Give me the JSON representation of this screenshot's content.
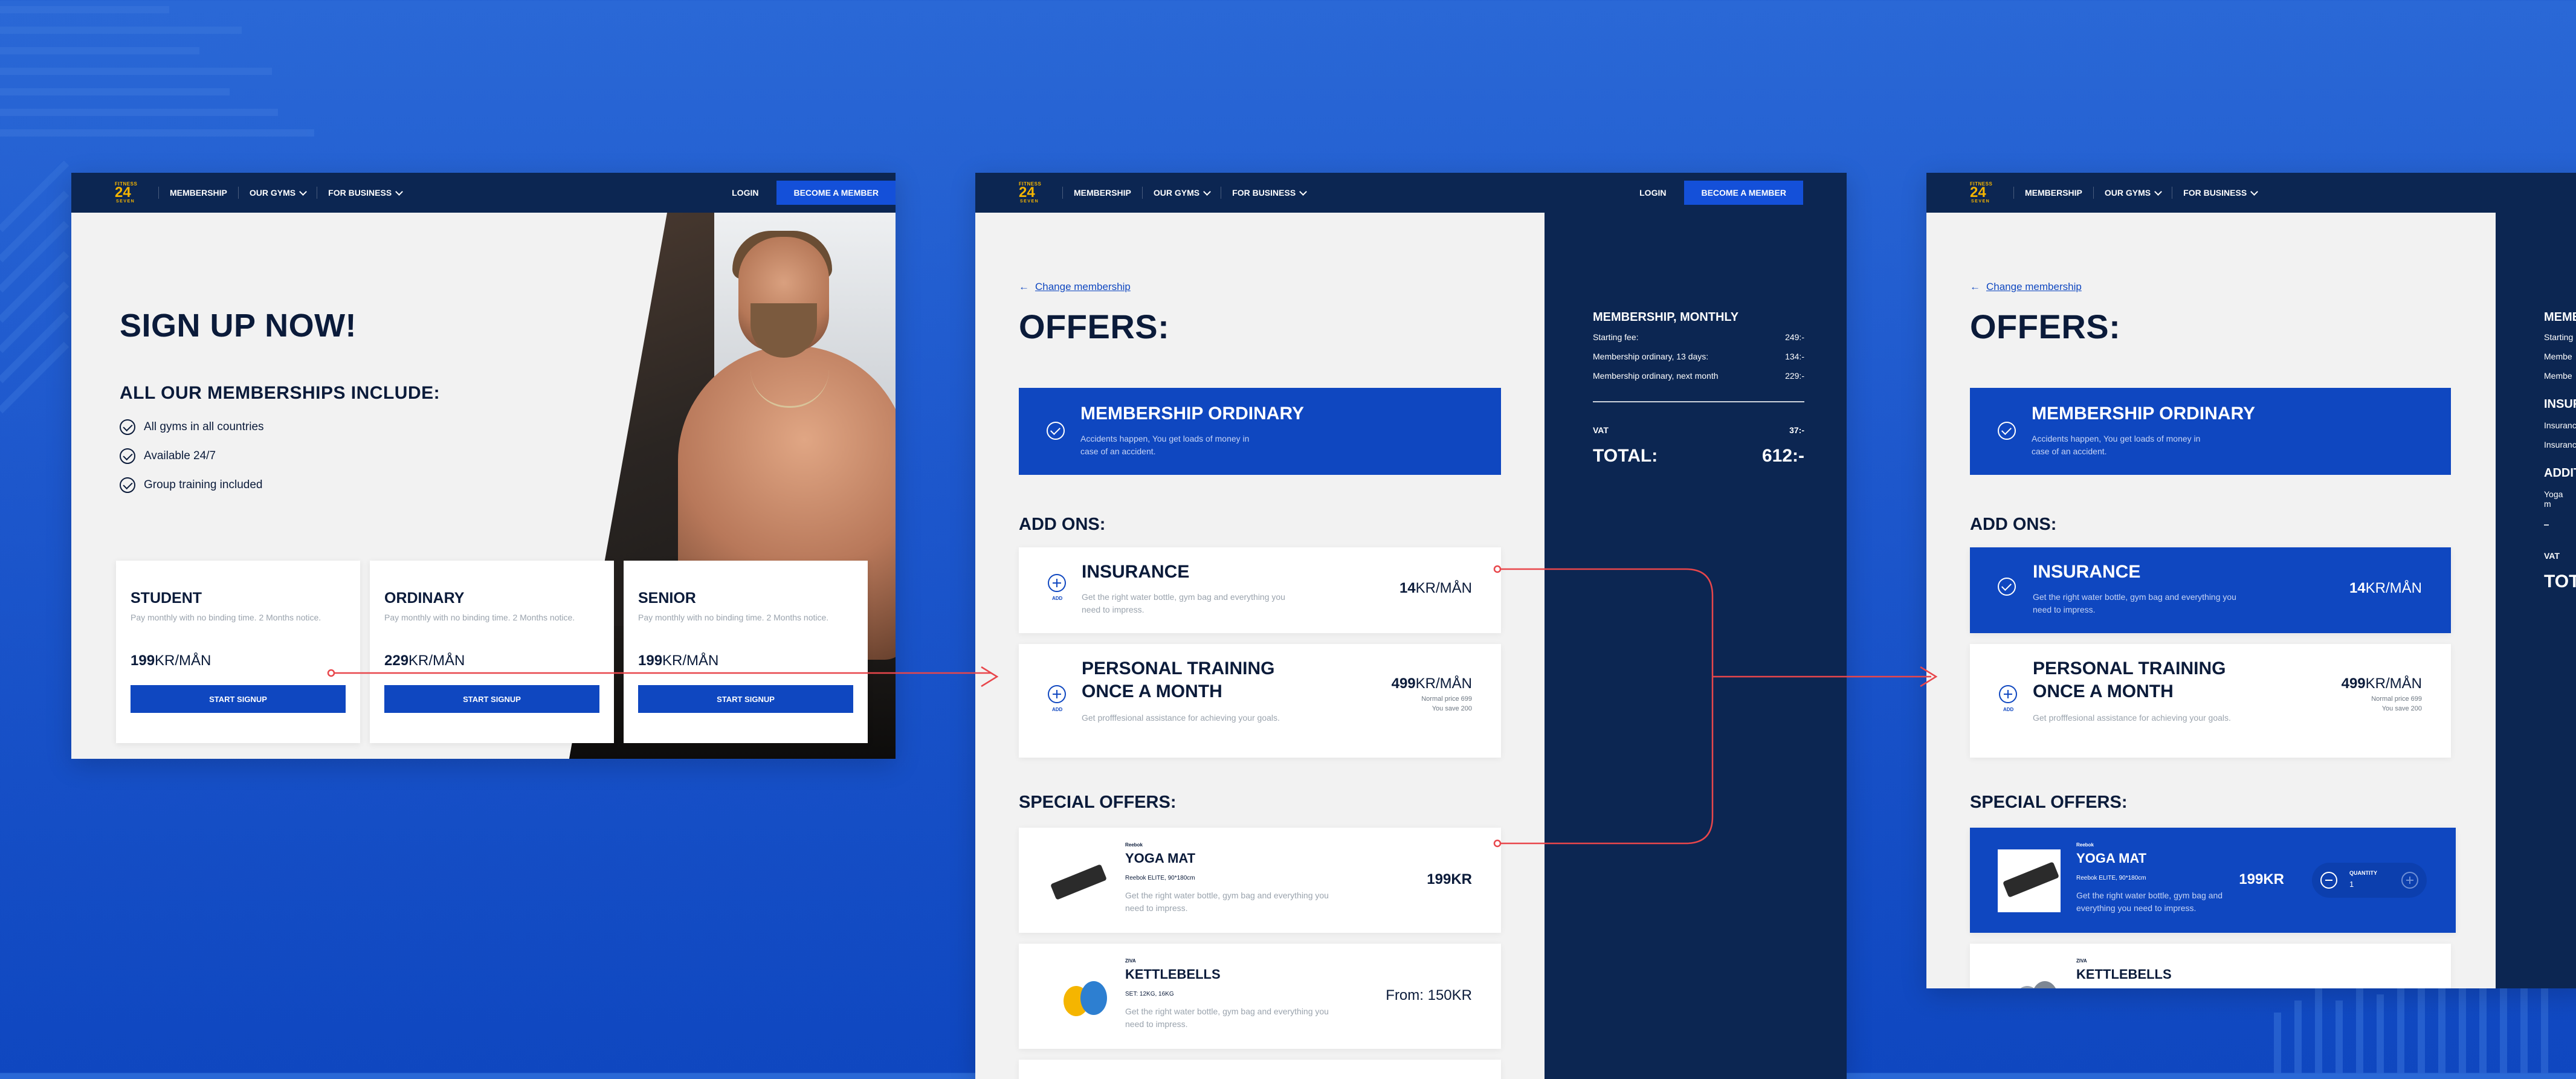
{
  "nav": {
    "logo_top": "FITNESS",
    "logo_mid": "24",
    "logo_bottom": "SEVEN",
    "items": [
      "MEMBERSHIP",
      "OUR GYMS",
      "FOR BUSINESS"
    ],
    "login": "LOGIN",
    "cta": "BECOME A MEMBER"
  },
  "signup": {
    "title": "SIGN UP NOW!",
    "subtitle": "ALL OUR MEMBERSHIPS INCLUDE:",
    "includes": [
      "All gyms in all countries",
      "Available 24/7",
      "Group training included"
    ],
    "plans": [
      {
        "name": "STUDENT",
        "desc": "Pay monthly with no binding time. 2 Months notice.",
        "price": "199",
        "unit": "KR/MÅN",
        "button": "START SIGNUP"
      },
      {
        "name": "ORDINARY",
        "desc": "Pay monthly with no binding time. 2 Months notice.",
        "price": "229",
        "unit": "KR/MÅN",
        "button": "START SIGNUP"
      },
      {
        "name": "SENIOR",
        "desc": "Pay monthly with no binding time. 2 Months notice.",
        "price": "199",
        "unit": "KR/MÅN",
        "button": "START SIGNUP"
      }
    ]
  },
  "offers": {
    "back": "Change membership",
    "title": "OFFERS:",
    "membership": {
      "title": "MEMBERSHIP ORDINARY",
      "desc": "Accidents happen, You get loads of money in case of an accident."
    },
    "addons_heading": "ADD ONS:",
    "addons": [
      {
        "title": "INSURANCE",
        "desc": "Get the right water bottle, gym bag and everything you need to impress.",
        "price": "14",
        "unit": "KR/MÅN",
        "add_label": "ADD"
      },
      {
        "title1": "PERSONAL TRAINING",
        "title2": "ONCE A MONTH",
        "desc": "Get profffesional assistance for achieving your goals.",
        "price": "499",
        "unit": "KR/MÅN",
        "normal": "Normal price 699",
        "save": "You save 200",
        "add_label": "ADD"
      }
    ],
    "special_heading": "SPECIAL OFFERS:",
    "specials": [
      {
        "brand": "Reebok",
        "title": "YOGA MAT",
        "spec": "Reebok ELITE, 90*180cm",
        "desc": "Get the right water bottle, gym bag and everything you need to impress.",
        "price": "199KR"
      },
      {
        "brand": "ZIVA",
        "title": "KETTLEBELLS",
        "spec": "SET: 12KG, 16KG",
        "desc": "Get the right water bottle, gym bag and everything you need to impress.",
        "price": "From: 150KR"
      }
    ],
    "quantity_label": "QUANTITY",
    "quantity_value": "1"
  },
  "summary": {
    "title": "MEMBERSHIP, MONTHLY",
    "rows": [
      {
        "label": "Starting fee:",
        "value": "249:-"
      },
      {
        "label": "Membership ordinary, 13 days:",
        "value": "134:-"
      },
      {
        "label": "Membership ordinary, next month",
        "value": "229:-"
      }
    ],
    "vat_label": "VAT",
    "vat_value": "37:-",
    "total_label": "TOTAL:",
    "total_value": "612:-"
  },
  "summary_partial": {
    "title": "MEME",
    "rows": [
      "Starting",
      "Membe",
      "Membe"
    ],
    "ins_heading": "INSUR",
    "ins_rows": [
      "Insuranc",
      "Insuranc"
    ],
    "add_heading": "ADDIT",
    "add_rows": [
      "Yoga m"
    ],
    "vat": "VAT",
    "total": "TOTA"
  },
  "colors": {
    "brand_blue": "#0f47c0",
    "navy": "#0c2652",
    "logo_yellow": "#f5b500",
    "connector": "#e8464b"
  }
}
